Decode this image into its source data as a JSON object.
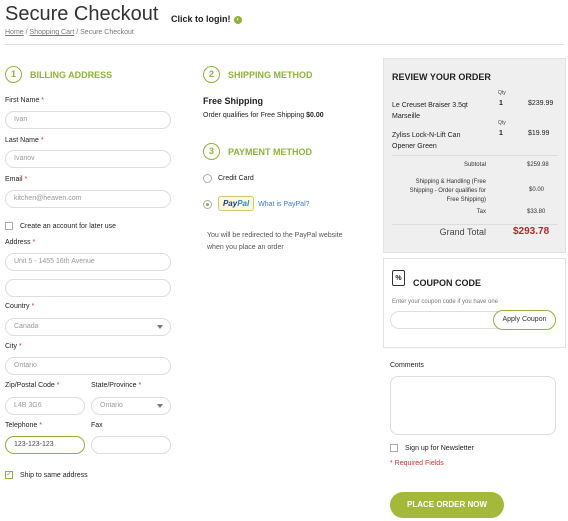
{
  "page": {
    "title": "Secure Checkout",
    "login_link": "Click to login!"
  },
  "breadcrumb": {
    "home": "Home",
    "cart": "Shopping Cart",
    "current": "Secure Checkout",
    "sep": " / "
  },
  "billing": {
    "step": "1",
    "heading": "BILLING ADDRESS",
    "first_name": {
      "label": "First Name",
      "value": "Ivan"
    },
    "last_name": {
      "label": "Last Name",
      "value": "Ivanov"
    },
    "email": {
      "label": "Email",
      "value": "kitchen@heaven.com"
    },
    "create_account": "Create an account for later use",
    "address": {
      "label": "Address",
      "value": "Unit 5 - 1455 16th Avenue",
      "value2": ""
    },
    "country": {
      "label": "Country",
      "value": "Canada"
    },
    "city": {
      "label": "City",
      "value": "Ontario"
    },
    "zip": {
      "label": "Zip/Postal Code",
      "value": "L4B 3G6"
    },
    "state": {
      "label": "State/Province",
      "value": "Ontario"
    },
    "telephone": {
      "label": "Telephone",
      "value": "123-123-123"
    },
    "fax": {
      "label": "Fax",
      "value": ""
    },
    "ship_same": "Ship to same address",
    "required_mark": "*"
  },
  "shipping": {
    "step": "2",
    "heading": "SHIPPING METHOD",
    "method": "Free Shipping",
    "note": "Order qualifies for Free Shipping",
    "amount": "$0.00"
  },
  "payment": {
    "step": "3",
    "heading": "PAYMENT METHOD",
    "credit_card": "Credit Card",
    "paypal_logo_a": "Pay",
    "paypal_logo_b": "Pal",
    "paypal_link": "What is PayPal?",
    "redirect_note_1": "You will be redirected to the PayPal website",
    "redirect_note_2": "when you place an order"
  },
  "review": {
    "heading": "REVIEW YOUR ORDER",
    "qty_label": "Qty",
    "items": [
      {
        "name_1": "Le Creuset Braiser 3.5qt",
        "name_2": "Marseille",
        "qty": "1",
        "price": "$239.99"
      },
      {
        "name_1": "Zyliss Lock-N-Lift Can",
        "name_2": "Opener Green",
        "qty": "1",
        "price": "$19.99"
      }
    ],
    "subtotal_label": "Subtotal",
    "subtotal": "$259.98",
    "shipping_label_1": "Shipping & Handling (Free",
    "shipping_label_2": "Shipping - Order qualifies for",
    "shipping_label_3": "Free Shipping)",
    "shipping": "$0.00",
    "tax_label": "Tax",
    "tax": "$33.80",
    "grand_label": "Grand Total",
    "grand": "$293.78"
  },
  "coupon": {
    "heading": "COUPON CODE",
    "icon_text": "%",
    "hint": "Enter your coupon code if you have one",
    "button": "Apply Coupon"
  },
  "comments": {
    "label": "Comments"
  },
  "newsletter": "Sign up for Newsletter",
  "required_note": "* Required Fields",
  "place_order": "PLACE ORDER NOW",
  "colors": {
    "accent": "#8db33a",
    "button": "#a4b93a",
    "grand_total": "#a3312c"
  }
}
